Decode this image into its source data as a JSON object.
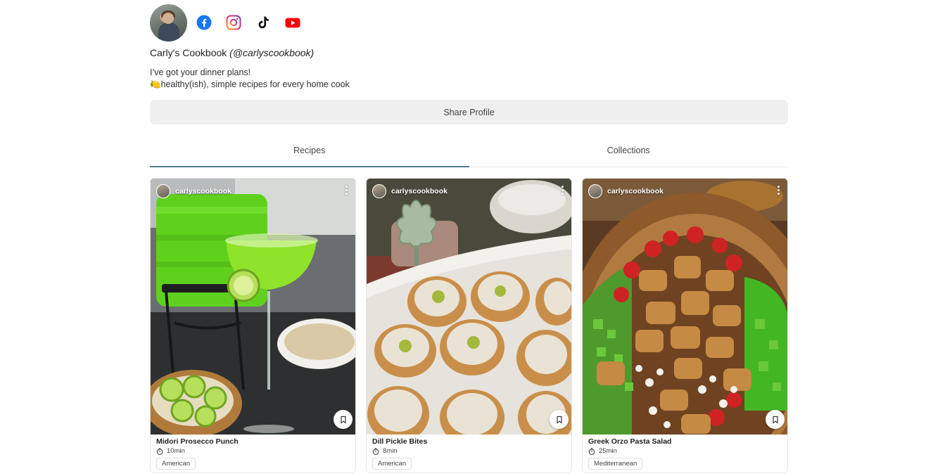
{
  "profile": {
    "name": "Carly's Cookbook",
    "handle": "(@carlyscookbook)",
    "bio_line1": "I’ve got your dinner plans!",
    "bio_line2_emoji": "🍋",
    "bio_line2": "healthy(ish), simple recipes for every home cook",
    "social": [
      "facebook-icon",
      "instagram-icon",
      "tiktok-icon",
      "youtube-icon"
    ],
    "share_label": "Share Profile"
  },
  "tabs": [
    {
      "label": "Recipes",
      "active": true
    },
    {
      "label": "Collections",
      "active": false
    }
  ],
  "cards": [
    {
      "user": "carlyscookbook",
      "title": "Midori Prosecco Punch",
      "time": "10min",
      "tag": "American"
    },
    {
      "user": "carlyscookbook",
      "title": "Dill Pickle Bites",
      "time": "8min",
      "tag": "American"
    },
    {
      "user": "carlyscookbook",
      "title": "Greek Orzo Pasta Salad",
      "time": "25min",
      "tag": "Mediterranean"
    }
  ],
  "colors": {
    "accent": "#4e7a8f",
    "button_bg": "#efefef",
    "facebook": "#1877f2",
    "youtube": "#ff0000"
  }
}
